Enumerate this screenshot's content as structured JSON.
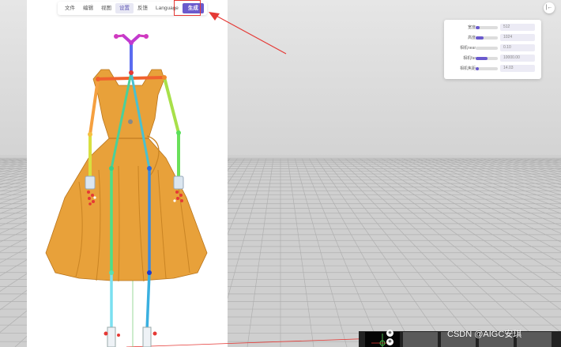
{
  "menu": {
    "items": [
      {
        "label": "文件"
      },
      {
        "label": "编辑"
      },
      {
        "label": "视图"
      },
      {
        "label": "设置",
        "active": true
      },
      {
        "label": "反馈"
      },
      {
        "label": "Language"
      },
      {
        "label": "生成",
        "primary": true
      }
    ]
  },
  "settings": {
    "rows": [
      {
        "label": "宽度",
        "value": "512",
        "fill": 0.18
      },
      {
        "label": "高度",
        "value": "1024",
        "fill": 0.36
      },
      {
        "label": "相机near",
        "value": "0.10",
        "fill": 0.0
      },
      {
        "label": "相机far",
        "value": "10000.00",
        "fill": 0.55
      },
      {
        "label": "相机焦距",
        "value": "14.03",
        "fill": 0.14
      }
    ]
  },
  "collapse_button": {
    "label": "|←"
  },
  "watermark": "CSDN @AIGC安琪",
  "colors": {
    "accent": "#6a5acd",
    "highlight": "#e53935",
    "dress": "#e8a13a"
  }
}
